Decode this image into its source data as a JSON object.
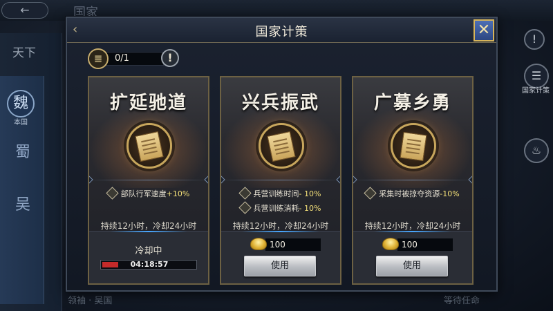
{
  "background": {
    "back_label": "←",
    "title": "国家",
    "tab_top": "天下",
    "side_items": [
      "魏",
      "蜀",
      "吴"
    ],
    "side_sub": "本国",
    "right_label": "国家计策",
    "bottom_left": "领袖 · 吴国",
    "bottom_right": "等待任命"
  },
  "dialog": {
    "title": "国家计策",
    "close_icon": "crossed-swords-icon",
    "token": {
      "count": "0/1",
      "icon": "scroll-icon"
    },
    "info_symbol": "!",
    "cards": [
      {
        "title": "扩延驰道",
        "emblem": "scroll-emblem-icon",
        "effects": [
          {
            "text": "部队行军速度",
            "value": "+10%"
          }
        ],
        "duration": "持续12小时，冷却24小时",
        "state": "cooldown",
        "cooldown_label": "冷却中",
        "cooldown_time": "04:18:57",
        "cooldown_progress": 0.17
      },
      {
        "title": "兴兵振武",
        "emblem": "scroll-emblem-icon",
        "effects": [
          {
            "text": "兵营训练时间",
            "value": "- 10%"
          },
          {
            "text": "兵营训练消耗",
            "value": "- 10%"
          }
        ],
        "duration": "持续12小时，冷却24小时",
        "state": "ready",
        "cost": "100",
        "button": "使用"
      },
      {
        "title": "广募乡勇",
        "emblem": "book-emblem-icon",
        "effects": [
          {
            "text": "采集时被掠夺资源",
            "value": "-10%"
          }
        ],
        "duration": "持续12小时，冷却24小时",
        "state": "ready",
        "cost": "100",
        "button": "使用"
      }
    ]
  },
  "colors": {
    "accent_gold": "#d7b45a",
    "highlight_pct": "#f5e27a",
    "cooldown_red": "#c52a2a",
    "glow_blue": "#49a7ff"
  }
}
